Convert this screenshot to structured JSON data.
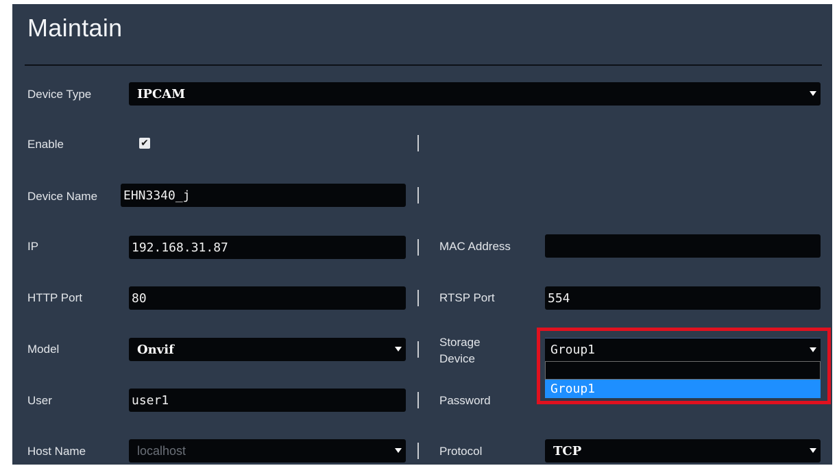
{
  "title": "Maintain",
  "device_type": {
    "label": "Device Type",
    "value": "IPCAM"
  },
  "enable": {
    "label": "Enable",
    "checked": true,
    "check_glyph": "✔"
  },
  "device_name": {
    "label": "Device Name",
    "value": "EHN3340_j"
  },
  "ip": {
    "label": "IP",
    "value": "192.168.31.87"
  },
  "mac_address": {
    "label": "MAC Address",
    "value": ""
  },
  "http_port": {
    "label": "HTTP Port",
    "value": "80"
  },
  "rtsp_port": {
    "label": "RTSP Port",
    "value": "554"
  },
  "model": {
    "label": "Model",
    "value": "Onvif"
  },
  "storage_device": {
    "label_line1": "Storage",
    "label_line2": "Device",
    "value": "Group1",
    "options": [
      "",
      "Group1"
    ],
    "highlighted_option": "Group1",
    "highlight_color": "#e0111f"
  },
  "user": {
    "label": "User",
    "value": "user1"
  },
  "password": {
    "label": "Password",
    "value": ""
  },
  "host_name": {
    "label": "Host Name",
    "value": "localhost",
    "disabled": true
  },
  "protocol": {
    "label": "Protocol",
    "value": "TCP"
  },
  "colors": {
    "background": "#2e3a4b",
    "field": "#05070a",
    "selection": "#1e8fff"
  }
}
